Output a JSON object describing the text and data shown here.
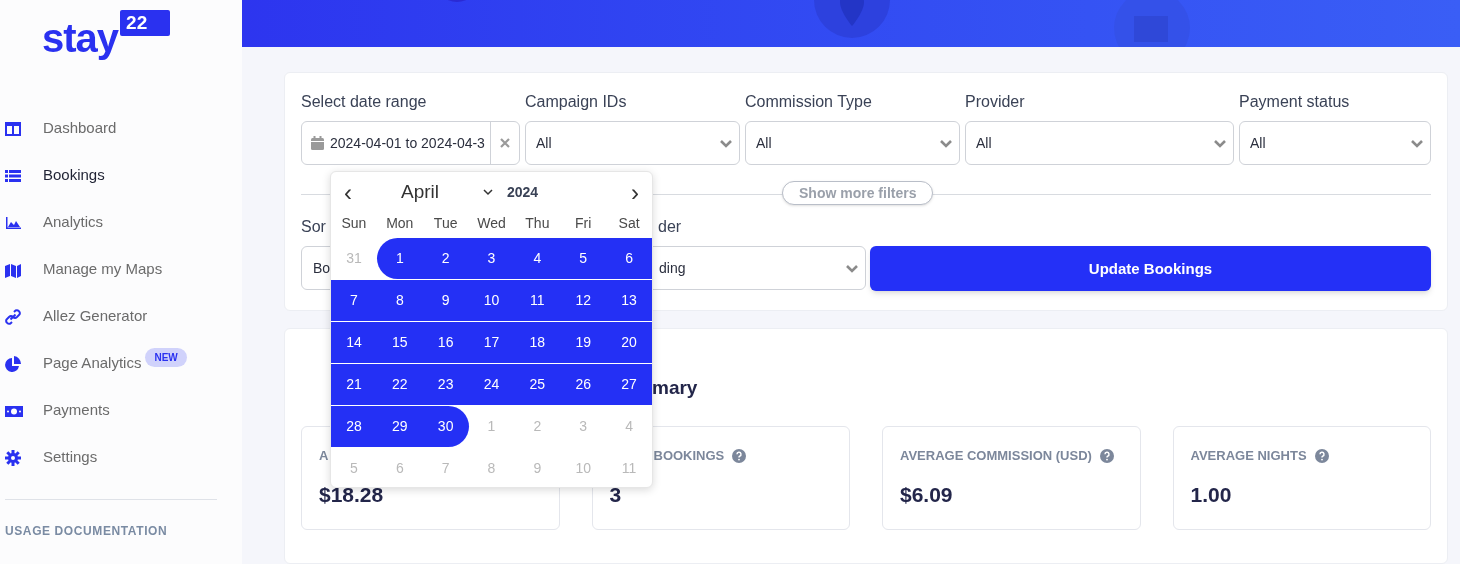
{
  "logo": {
    "word": "stay",
    "badge": "22"
  },
  "sidebar": {
    "items": [
      {
        "label": "Dashboard",
        "selected": false
      },
      {
        "label": "Bookings",
        "selected": true
      },
      {
        "label": "Analytics",
        "selected": false
      },
      {
        "label": "Manage my Maps",
        "selected": false
      },
      {
        "label": "Allez Generator",
        "selected": false
      },
      {
        "label": "Page Analytics",
        "selected": false,
        "badge": "NEW"
      },
      {
        "label": "Payments",
        "selected": false
      },
      {
        "label": "Settings",
        "selected": false
      }
    ],
    "section_heading": "USAGE DOCUMENTATION"
  },
  "filters": {
    "date_range": {
      "label": "Select date range",
      "value": "2024-04-01 to 2024-04-3"
    },
    "selects": [
      {
        "label": "Campaign IDs",
        "value": "All"
      },
      {
        "label": "Commission Type",
        "value": "All"
      },
      {
        "label": "Provider",
        "value": "All"
      },
      {
        "label": "Payment status",
        "value": "All"
      }
    ],
    "more_filters": "Show more filters",
    "sort_by": {
      "label": "Sor",
      "value": "Bo"
    },
    "sort_order": {
      "label": "der",
      "value": "ding"
    },
    "update_button": "Update Bookings"
  },
  "summary": {
    "heading": "mary",
    "stats": [
      {
        "label": "A",
        "value": "$18.28",
        "help": false
      },
      {
        "label": "BOOKINGS",
        "value": "3",
        "help": true
      },
      {
        "label": "AVERAGE COMMISSION (USD)",
        "value": "$6.09",
        "help": true
      },
      {
        "label": "AVERAGE NIGHTS",
        "value": "1.00",
        "help": true
      }
    ]
  },
  "calendar": {
    "month": "April",
    "year": "2024",
    "prev": "‹",
    "next": "›",
    "weekdays": [
      "Sun",
      "Mon",
      "Tue",
      "Wed",
      "Thu",
      "Fri",
      "Sat"
    ],
    "weeks": [
      [
        {
          "day": "31",
          "outside": true,
          "in_range": false
        },
        {
          "day": "1",
          "outside": false,
          "in_range": true
        },
        {
          "day": "2",
          "outside": false,
          "in_range": true
        },
        {
          "day": "3",
          "outside": false,
          "in_range": true
        },
        {
          "day": "4",
          "outside": false,
          "in_range": true
        },
        {
          "day": "5",
          "outside": false,
          "in_range": true
        },
        {
          "day": "6",
          "outside": false,
          "in_range": true
        }
      ],
      [
        {
          "day": "7",
          "outside": false,
          "in_range": true
        },
        {
          "day": "8",
          "outside": false,
          "in_range": true
        },
        {
          "day": "9",
          "outside": false,
          "in_range": true
        },
        {
          "day": "10",
          "outside": false,
          "in_range": true
        },
        {
          "day": "11",
          "outside": false,
          "in_range": true
        },
        {
          "day": "12",
          "outside": false,
          "in_range": true
        },
        {
          "day": "13",
          "outside": false,
          "in_range": true
        }
      ],
      [
        {
          "day": "14",
          "outside": false,
          "in_range": true
        },
        {
          "day": "15",
          "outside": false,
          "in_range": true
        },
        {
          "day": "16",
          "outside": false,
          "in_range": true
        },
        {
          "day": "17",
          "outside": false,
          "in_range": true
        },
        {
          "day": "18",
          "outside": false,
          "in_range": true
        },
        {
          "day": "19",
          "outside": false,
          "in_range": true
        },
        {
          "day": "20",
          "outside": false,
          "in_range": true
        }
      ],
      [
        {
          "day": "21",
          "outside": false,
          "in_range": true
        },
        {
          "day": "22",
          "outside": false,
          "in_range": true
        },
        {
          "day": "23",
          "outside": false,
          "in_range": true
        },
        {
          "day": "24",
          "outside": false,
          "in_range": true
        },
        {
          "day": "25",
          "outside": false,
          "in_range": true
        },
        {
          "day": "26",
          "outside": false,
          "in_range": true
        },
        {
          "day": "27",
          "outside": false,
          "in_range": true
        }
      ],
      [
        {
          "day": "28",
          "outside": false,
          "in_range": true
        },
        {
          "day": "29",
          "outside": false,
          "in_range": true
        },
        {
          "day": "30",
          "outside": false,
          "in_range": true
        },
        {
          "day": "1",
          "outside": true,
          "in_range": false
        },
        {
          "day": "2",
          "outside": true,
          "in_range": false
        },
        {
          "day": "3",
          "outside": true,
          "in_range": false
        },
        {
          "day": "4",
          "outside": true,
          "in_range": false
        }
      ],
      [
        {
          "day": "5",
          "outside": true,
          "in_range": false
        },
        {
          "day": "6",
          "outside": true,
          "in_range": false
        },
        {
          "day": "7",
          "outside": true,
          "in_range": false
        },
        {
          "day": "8",
          "outside": true,
          "in_range": false
        },
        {
          "day": "9",
          "outside": true,
          "in_range": false
        },
        {
          "day": "10",
          "outside": true,
          "in_range": false
        },
        {
          "day": "11",
          "outside": true,
          "in_range": false
        }
      ]
    ]
  }
}
